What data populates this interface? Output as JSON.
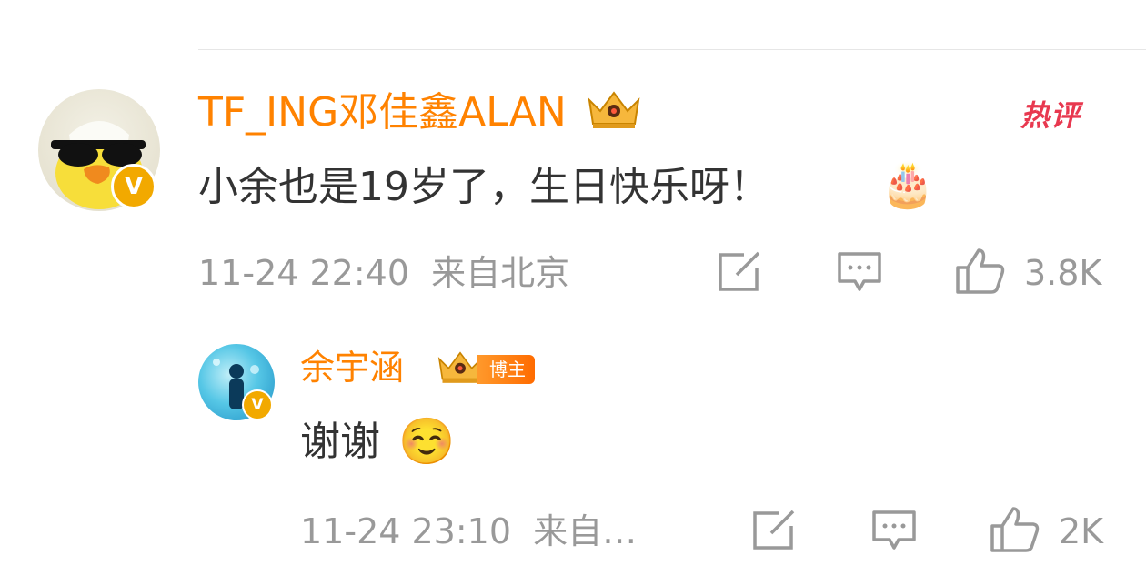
{
  "comment": {
    "username": "TF_ING邓佳鑫ALAN",
    "hot_tag": "热评",
    "text": "小余也是19岁了，生日快乐呀！",
    "emoji": "🎂",
    "meta": "11-24 22:40  来自北京",
    "like_count": "3.8K"
  },
  "reply": {
    "username": "余宇涵",
    "badge": "博主",
    "text": "谢谢",
    "emoji": "☺️",
    "meta": "11-24 23:10  来自…",
    "like_count": "2K"
  },
  "colors": {
    "username": "#ff8200",
    "meta": "#999999",
    "hot": "#e8384f",
    "verified_badge": "#f2a900"
  },
  "icons": [
    "verified-v-icon",
    "crown-icon",
    "share-icon",
    "comment-icon",
    "like-icon"
  ]
}
